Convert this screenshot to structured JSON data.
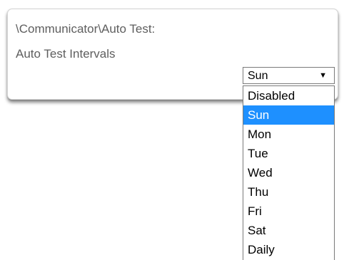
{
  "panel": {
    "path": "\\Communicator\\Auto Test:",
    "setting_label": "Auto Test Intervals"
  },
  "select": {
    "current_value": "Sun",
    "arrow_icon": "dropdown-arrow-icon",
    "arrow_glyph": "▼",
    "options": [
      "Disabled",
      "Sun",
      "Mon",
      "Tue",
      "Wed",
      "Thu",
      "Fri",
      "Sat",
      "Daily"
    ],
    "highlighted_index": 1
  },
  "colors": {
    "highlight": "#1e90ff",
    "label_text": "#5e5e5e"
  }
}
